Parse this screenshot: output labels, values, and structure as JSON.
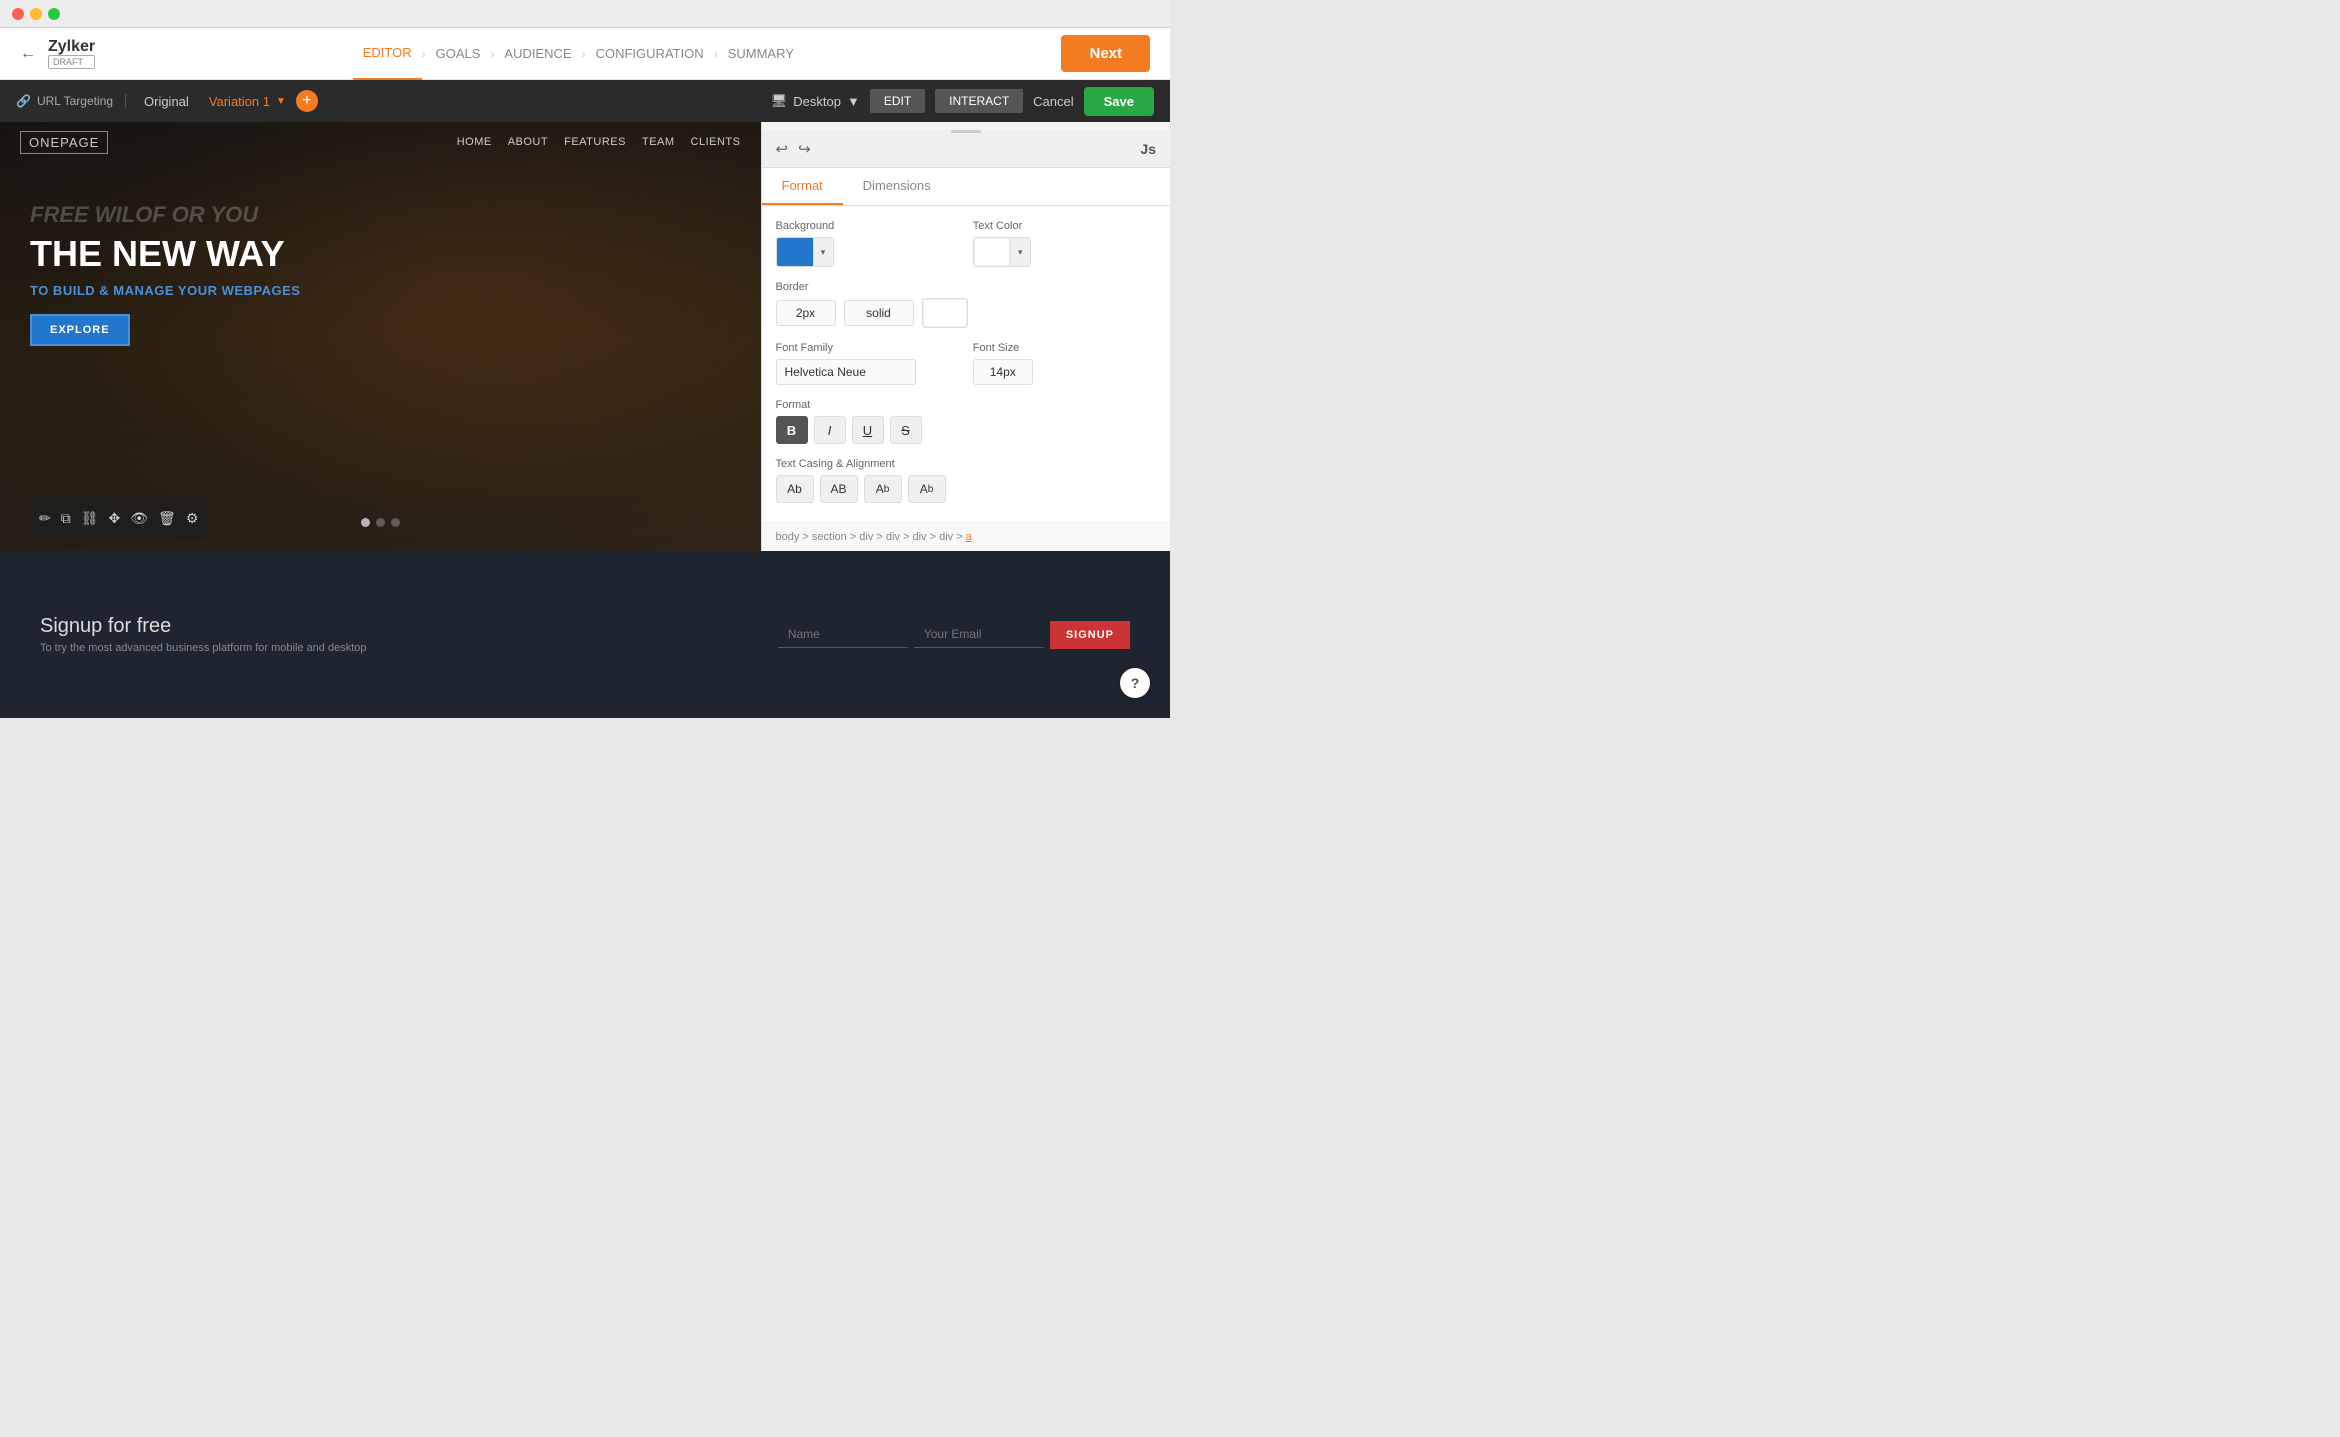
{
  "titlebar": {
    "traffic_lights": [
      "red",
      "yellow",
      "green"
    ]
  },
  "topnav": {
    "back_icon": "←",
    "brand_name": "Zylker",
    "brand_badge": "DRAFT",
    "steps": [
      {
        "label": "EDITOR",
        "active": true
      },
      {
        "label": "GOALS",
        "active": false
      },
      {
        "label": "AUDIENCE",
        "active": false
      },
      {
        "label": "CONFIGURATION",
        "active": false
      },
      {
        "label": "SUMMARY",
        "active": false
      }
    ],
    "next_label": "Next"
  },
  "secondary_bar": {
    "url_targeting_label": "URL Targeting",
    "tab_original": "Original",
    "tab_variation": "Variation 1",
    "dropdown_arrow": "▼",
    "add_icon": "+",
    "device_icon": "🖥",
    "device_label": "Desktop",
    "device_arrow": "▼",
    "edit_label": "EDIT",
    "interact_label": "INTERACT",
    "cancel_label": "Cancel",
    "save_label": "Save"
  },
  "website": {
    "logo": "ONEPAGE",
    "menu": [
      "HOME",
      "ABOUT",
      "FEATURES",
      "TEAM",
      "CLIENTS"
    ],
    "hero_faded": "FREE\nWILOF\nOR YOU",
    "hero_title": "THE NEW WAY",
    "hero_subtitle": "TO BUILD & MANAGE YOUR\nWEBPAGES",
    "explore_btn": "EXPLORE",
    "carousel_dots": [
      true,
      false,
      false
    ],
    "signup_title": "Signup for free",
    "signup_desc": "To try the most advanced business platform for mobile and desktop",
    "signup_name_placeholder": "Name",
    "signup_email_placeholder": "Your Email",
    "signup_btn": "SIGNUP"
  },
  "panel": {
    "undo_icon": "↩",
    "redo_icon": "↪",
    "element_label": "Js",
    "drag_handle": "≡",
    "tabs": [
      "Format",
      "Dimensions"
    ],
    "active_tab": "Format",
    "background_label": "Background",
    "background_color": "#2277cc",
    "text_color_label": "Text Color",
    "text_color": "#ffffff",
    "border_label": "Border",
    "border_width": "2px",
    "border_style": "solid",
    "border_color": "#ffffff",
    "font_family_label": "Font Family",
    "font_family": "Helvetica Neue",
    "font_size_label": "Font Size",
    "font_size": "14px",
    "format_label": "Format",
    "format_buttons": [
      {
        "label": "B",
        "active": true,
        "name": "bold"
      },
      {
        "label": "I",
        "active": false,
        "name": "italic"
      },
      {
        "label": "U",
        "active": false,
        "name": "underline"
      },
      {
        "label": "S",
        "active": false,
        "name": "strikethrough"
      }
    ],
    "casing_label": "Text Casing & Alignment",
    "casing_buttons": [
      {
        "label": "Ab",
        "name": "sentence-case"
      },
      {
        "label": "AB",
        "name": "uppercase"
      },
      {
        "label": "Aᵇ",
        "name": "mixed-case"
      },
      {
        "label": "Aᵦ",
        "name": "lowercase"
      }
    ],
    "breadcrumb": "body > section > div > div > div > div > a"
  },
  "help": {
    "icon": "?"
  }
}
